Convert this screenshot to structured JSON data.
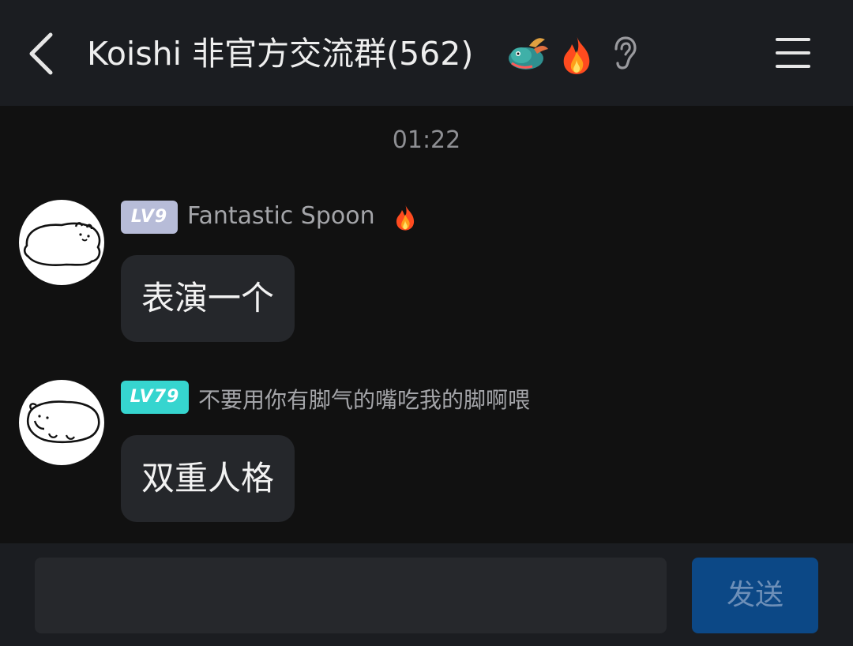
{
  "header": {
    "back_icon": "chevron-left-icon",
    "title": "Koishi 非官方交流群(562)",
    "badges": [
      "dragon-icon",
      "fire-icon",
      "ear-icon"
    ],
    "menu_icon": "hamburger-menu-icon"
  },
  "chat": {
    "timestamp": "01:22",
    "messages": [
      {
        "level": "LV9",
        "sender": "Fantastic Spoon",
        "sender_badge": "fire-icon",
        "text": "表演一个",
        "avatar": "cat-doodle-avatar"
      },
      {
        "level": "LV79",
        "sender": "不要用你有脚气的嘴吃我的脚啊喂",
        "text": "双重人格",
        "avatar": "cat-doodle-avatar"
      }
    ]
  },
  "composer": {
    "input_value": "",
    "send_label": "发送"
  },
  "colors": {
    "background": "#111111",
    "header_bg": "#1b1d21",
    "bubble_bg": "#25272b",
    "lv9_badge": "#b7bcd8",
    "lv79_badge": "#36d5cf",
    "send_button": "#0c4886"
  }
}
